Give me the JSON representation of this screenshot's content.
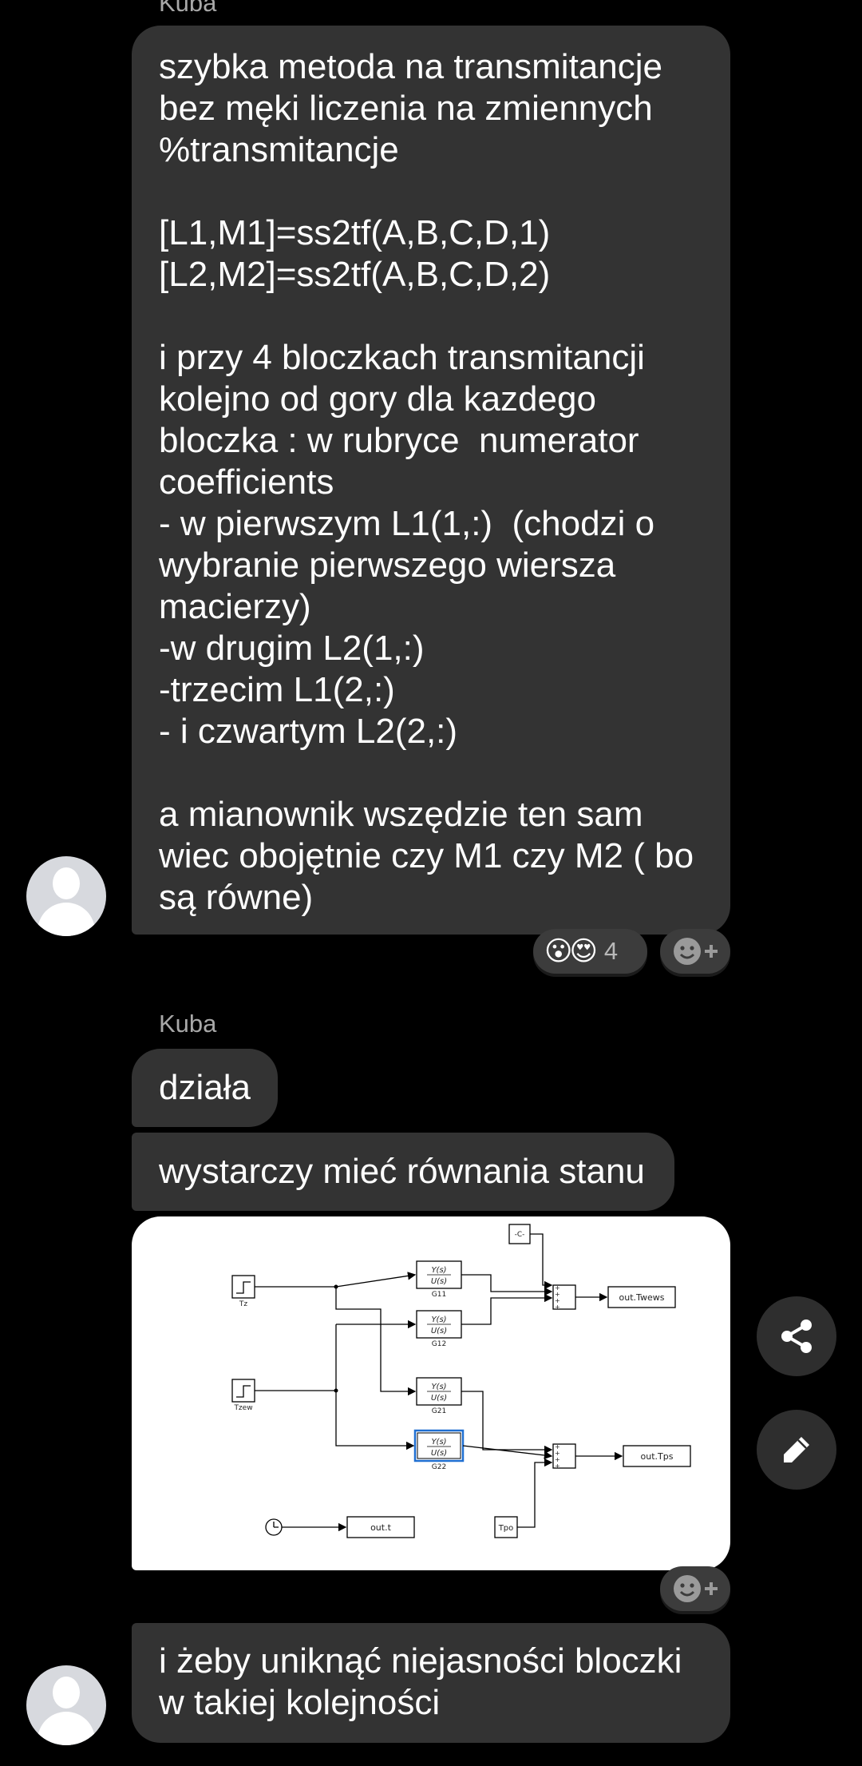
{
  "messages": [
    {
      "sender": "Kuba",
      "lines": [
        "szybka metoda na transmitancje",
        "bez męki liczenia na zmiennych",
        "%transmitancje",
        "",
        "[L1,M1]=ss2tf(A,B,C,D,1)",
        "[L2,M2]=ss2tf(A,B,C,D,2)",
        "",
        "i przy 4 bloczkach transmitancji",
        "kolejno od gory dla kazdego",
        "bloczka : w rubryce  numerator",
        "coefficients",
        "- w pierwszym L1(1,:)  (chodzi o",
        "wybranie pierwszego wiersza",
        "macierzy)",
        "-w drugim L2(1,:)",
        "-trzecim L1(2,:)",
        "- i czwartym L2(2,:)",
        "",
        "a mianownik wszędzie ten sam",
        "wiec obojętnie czy M1 czy M2 ( bo",
        "są równe)"
      ],
      "reaction": {
        "emojis": [
          "😮",
          "😍"
        ],
        "count": "4"
      }
    }
  ],
  "second_group": {
    "sender": "Kuba",
    "msg1": "działa",
    "msg2": "wystarczy mieć równania stanu",
    "msg3_lines": [
      "i żeby uniknąć niejasności bloczki",
      "w takiej kolejności"
    ]
  },
  "diagram": {
    "const_label": "-C-",
    "step1_label": "Tz",
    "step2_label": "Tzew",
    "tf_num": "Y(s)",
    "tf_den": "U(s)",
    "g11": "G11",
    "g12": "G12",
    "g21": "G21",
    "g22": "G22",
    "out1": "out.Twews",
    "out2": "out.Tps",
    "out3": "out.t",
    "tpo": "Tpo"
  },
  "actions": {
    "share_icon": "share-icon",
    "edit_icon": "pencil-icon",
    "add_reaction_icon": "emoji-plus-icon"
  },
  "colors": {
    "bubble": "#333333",
    "background": "#000000",
    "selected_block": "#1f6fd1"
  }
}
